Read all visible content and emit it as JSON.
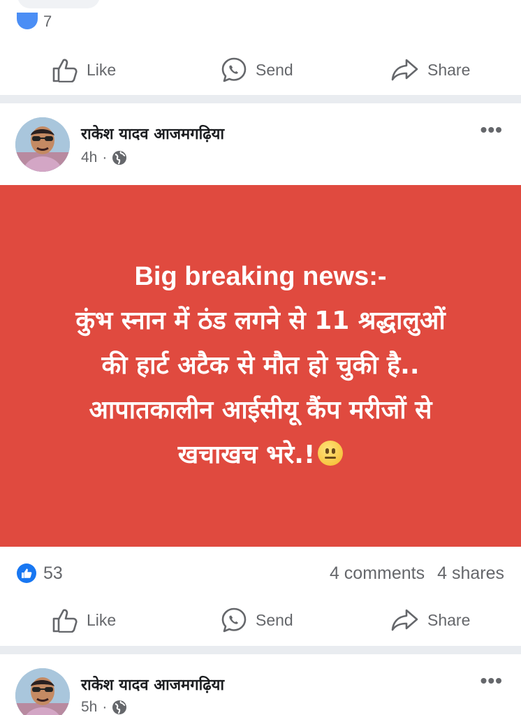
{
  "previous_post": {
    "reaction_count": "7"
  },
  "actions": {
    "like": "Like",
    "send": "Send",
    "share": "Share"
  },
  "post1": {
    "author": "राकेश यादव आजमगढ़िया",
    "time": "4h",
    "separator": "·",
    "more": "•••",
    "banner": {
      "background": "#e04a3f",
      "title": "Big breaking news:-",
      "lines": [
        "कुंभ स्नान में ठंड लगने से 11 श्रद्धालुओं",
        "की हार्ट अटैक से मौत हो चुकी है..",
        "आपातकालीन आईसीयू कैंप मरीजों से",
        "खचाखच भरे.!"
      ],
      "emoji": "neutral-face-emoji"
    },
    "reactions": "53",
    "comments": "4 comments",
    "shares": "4 shares"
  },
  "post2": {
    "author": "राकेश यादव आजमगढ़िया",
    "time": "5h",
    "separator": "·",
    "more": "•••"
  },
  "colors": {
    "accent": "#1877f2",
    "muted_text": "#65676b",
    "separator": "#e9ecf0"
  }
}
